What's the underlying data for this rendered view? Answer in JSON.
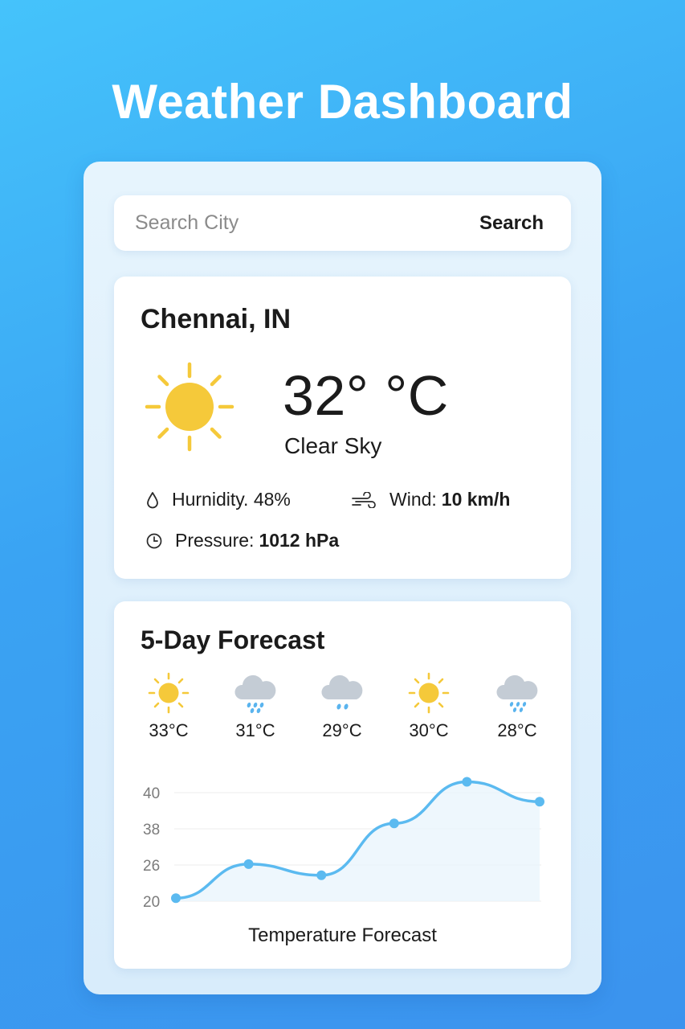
{
  "header": {
    "title": "Weather Dashboard"
  },
  "search": {
    "placeholder": "Search City",
    "button_label": "Search"
  },
  "current": {
    "city": "Chennai, IN",
    "temperature": "32° °C",
    "condition": "Clear Sky",
    "condition_icon": "sun-icon",
    "humidity_text": "Hurnidity. 48%",
    "wind_label": "Wind:",
    "wind_value": "10 km/h",
    "pressure_label": "Pressure:",
    "pressure_value": "1012 hPa"
  },
  "forecast": {
    "title": "5-Day Forecast",
    "days": [
      {
        "icon": "sun-icon",
        "temp": "33°C"
      },
      {
        "icon": "rain-cloud-icon",
        "temp": "31°C"
      },
      {
        "icon": "rain-cloud-icon",
        "temp": "29°C"
      },
      {
        "icon": "sun-icon",
        "temp": "30°C"
      },
      {
        "icon": "rain-cloud-icon",
        "temp": "28°C"
      }
    ]
  },
  "chart_data": {
    "type": "line",
    "title": "Temperature Forecast",
    "y_ticks": [
      "40",
      "38",
      "26",
      "20"
    ],
    "values": [
      20.5,
      26.3,
      24.3,
      38.3,
      40.6,
      39.5
    ],
    "grid": true,
    "colors": {
      "line": "#5bbaf0",
      "fill": "#eaf5fd"
    }
  },
  "colors": {
    "sun": "#f5c93a",
    "cloud": "#c4ccd5",
    "rain": "#5ab4ee",
    "accent": "#3b9cf1"
  }
}
